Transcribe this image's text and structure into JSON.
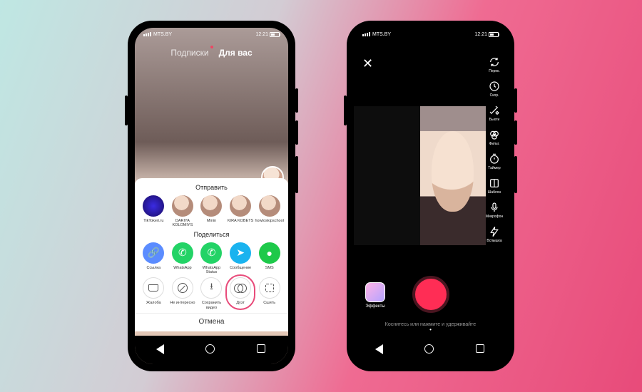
{
  "statusbar": {
    "carrier": "MTS.BY",
    "time": "12:21"
  },
  "phone1": {
    "tabs": {
      "following": "Подписки",
      "for_you": "Для вас"
    },
    "sheet": {
      "send_title": "Отправить",
      "friends": [
        {
          "name": "TikTokeri.ru"
        },
        {
          "name": "DARIYA KOLOMIYS"
        },
        {
          "name": "Minin"
        },
        {
          "name": "KIRA KOBETS"
        },
        {
          "name": "howtoskipschool"
        }
      ],
      "share_title": "Поделиться",
      "share": [
        {
          "label": "Ссылка"
        },
        {
          "label": "WhatsApp"
        },
        {
          "label": "WhatsApp Status"
        },
        {
          "label": "Сообщение"
        },
        {
          "label": "SMS"
        }
      ],
      "actions": [
        {
          "label": "Жалоба"
        },
        {
          "label": "Не интересно"
        },
        {
          "label": "Сохранить видео"
        },
        {
          "label": "Дуэт"
        },
        {
          "label": "Сшить"
        }
      ],
      "cancel": "Отмена"
    }
  },
  "phone2": {
    "tools": [
      {
        "label": "Перек."
      },
      {
        "label": "Скор."
      },
      {
        "label": "Бьюти"
      },
      {
        "label": "Фильт."
      },
      {
        "label": "Таймер"
      },
      {
        "label": "Шаблон"
      },
      {
        "label": "Микрофон"
      },
      {
        "label": "Вспышка"
      }
    ],
    "effects": "Эффекты",
    "hint": "Коснитесь или нажмите и удерживайте"
  },
  "colors": {
    "accent": "#ff2d55",
    "highlight": "#e84b7a"
  }
}
